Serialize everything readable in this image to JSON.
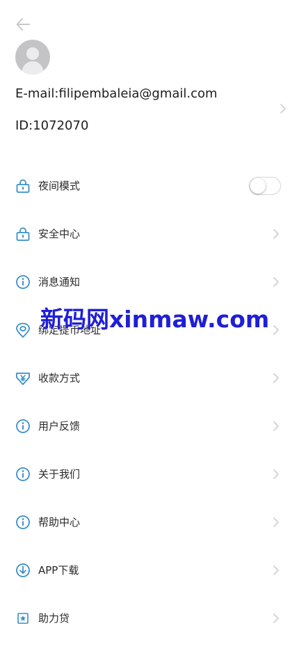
{
  "colors": {
    "icon_blue": "#3a8fc9",
    "chevron": "#cfcfcf",
    "avatar_bg": "#c4c4c6",
    "watermark": "#1f1fd6"
  },
  "header": {
    "back_icon": "arrow-left-icon"
  },
  "profile": {
    "email": "E-mail:filipembaleia@gmail.com",
    "id": "ID:1072070",
    "avatar_icon": "user-avatar-icon"
  },
  "menu": {
    "items": [
      {
        "label": "夜间模式",
        "icon": "lock-icon",
        "control": "toggle",
        "toggle_on": false
      },
      {
        "label": "安全中心",
        "icon": "lock-icon",
        "control": "chevron"
      },
      {
        "label": "消息通知",
        "icon": "info-icon",
        "control": "chevron"
      },
      {
        "label": "绑定提币地址",
        "icon": "location-icon",
        "control": "chevron"
      },
      {
        "label": "收款方式",
        "icon": "yen-shield-icon",
        "control": "chevron"
      },
      {
        "label": "用户反馈",
        "icon": "info-icon",
        "control": "chevron"
      },
      {
        "label": "关于我们",
        "icon": "info-icon",
        "control": "chevron"
      },
      {
        "label": "帮助中心",
        "icon": "info-icon",
        "control": "chevron"
      },
      {
        "label": "APP下载",
        "icon": "download-icon",
        "control": "chevron"
      },
      {
        "label": "助力贷",
        "icon": "star-box-icon",
        "control": "chevron"
      }
    ]
  },
  "watermark": {
    "text": "新码网xinmaw.com"
  }
}
